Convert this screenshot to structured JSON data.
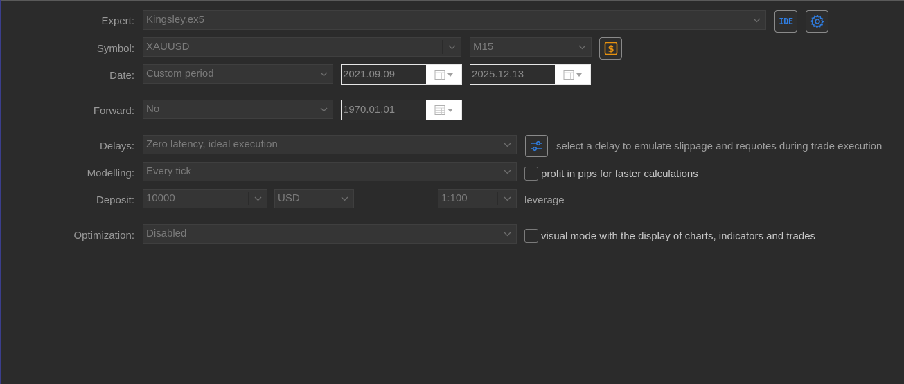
{
  "labels": {
    "expert": "Expert:",
    "symbol": "Symbol:",
    "date": "Date:",
    "forward": "Forward:",
    "delays": "Delays:",
    "modelling": "Modelling:",
    "deposit": "Deposit:",
    "optimization": "Optimization:"
  },
  "expert": {
    "value": "Kingsley.ex5",
    "ide_label": "IDE"
  },
  "symbol": {
    "value": "XAUUSD",
    "timeframe": "M15"
  },
  "date": {
    "period": "Custom period",
    "from": "2021.09.09",
    "to": "2025.12.13"
  },
  "forward": {
    "value": "No",
    "date": "1970.01.01"
  },
  "delays": {
    "value": "Zero latency, ideal execution",
    "hint": "select a delay to emulate slippage and requotes during trade execution"
  },
  "modelling": {
    "value": "Every tick",
    "checkbox_label": "profit in pips for faster calculations",
    "checked": false
  },
  "deposit": {
    "amount": "10000",
    "currency": "USD",
    "leverage": "1:100",
    "leverage_label": "leverage"
  },
  "optimization": {
    "value": "Disabled",
    "checkbox_label": "visual mode with the display of charts, indicators and trades",
    "checked": false
  },
  "colors": {
    "background": "#2b2b2b",
    "accent_blue": "#2f7de1",
    "accent_orange": "#e8920f",
    "left_border": "#3b3e8c"
  }
}
